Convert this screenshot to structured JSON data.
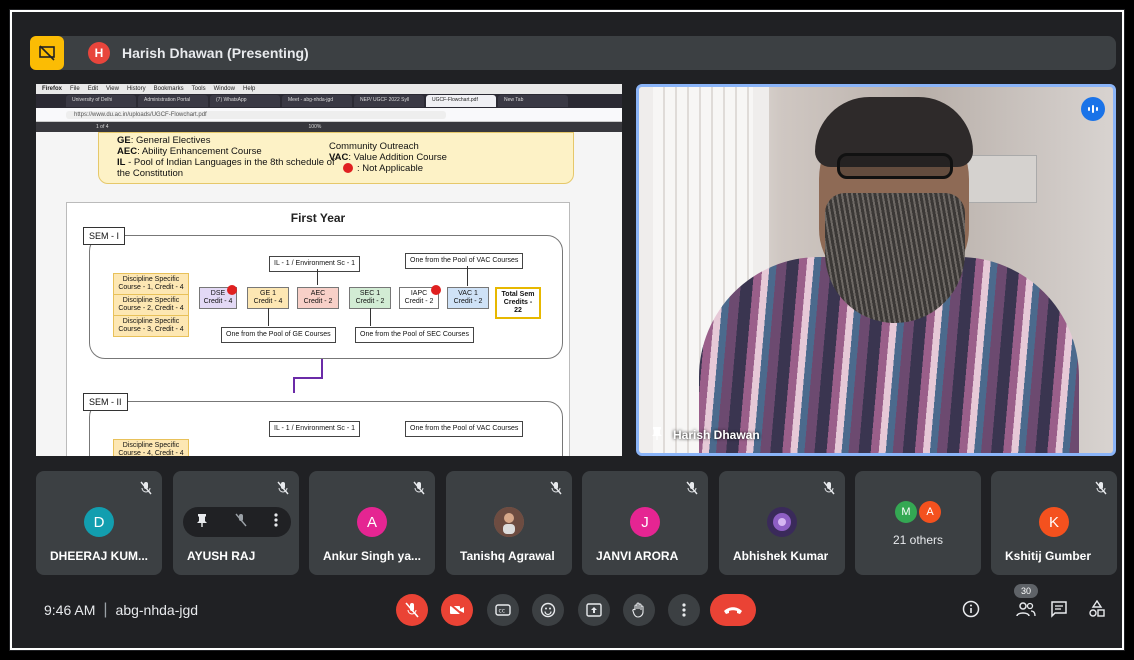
{
  "presenter": {
    "initial": "H",
    "title": "Harish Dhawan (Presenting)"
  },
  "shared_screen": {
    "menubar": [
      "Firefox",
      "File",
      "Edit",
      "View",
      "History",
      "Bookmarks",
      "Tools",
      "Window",
      "Help"
    ],
    "tabs": [
      "University of Delhi",
      "Administration Portal",
      "(7) WhatsApp",
      "Meet - abg-nhda-jgd",
      "NEP/ UGCF 2022 Syll",
      "UGCF-Flowchart.pdf",
      "New Tab"
    ],
    "url": "https://www.du.ac.in/uploads/UGCF-Flowchart.pdf",
    "pdf_page": "1 of 4",
    "pdf_zoom": "100%",
    "legend_left": [
      {
        "key": "GE",
        "text": ": General Electives"
      },
      {
        "key": "AEC",
        "text": ": Ability Enhancement Course"
      },
      {
        "key": "IL",
        "text": " - Pool of Indian Languages in the 8th schedule of the Constitution"
      }
    ],
    "legend_right": [
      {
        "key": "",
        "text": "Community Outreach"
      },
      {
        "key": "VAC",
        "text": ": Value Addition Course"
      },
      {
        "key": "",
        "text": ": Not Applicable"
      }
    ],
    "year_title": "First Year",
    "sem1": {
      "label": "SEM - I",
      "ds": [
        "Discipline Specific Course - 1, Credit - 4",
        "Discipline Specific Course - 2, Credit - 4",
        "Discipline Specific Course - 3, Credit - 4"
      ],
      "top_notes": [
        "IL - 1 / Environment Sc - 1",
        "One from the Pool of VAC Courses"
      ],
      "nodes": [
        {
          "name": "DSE",
          "credit": "Credit - 4",
          "color": "#e3d9f5"
        },
        {
          "name": "GE 1",
          "credit": "Credit - 4",
          "color": "#fde7b3"
        },
        {
          "name": "AEC",
          "credit": "Credit - 2",
          "color": "#f8d0c8"
        },
        {
          "name": "SEC 1",
          "credit": "Credit - 2",
          "color": "#d2ecd4"
        },
        {
          "name": "IAPC",
          "credit": "Credit - 2",
          "color": "#ffffff"
        },
        {
          "name": "VAC 1",
          "credit": "Credit - 2",
          "color": "#cfe2f7"
        }
      ],
      "total": "Total Sem Credits - 22",
      "bottom_notes": [
        "One from the Pool of GE Courses",
        "One from the Pool of SEC Courses"
      ]
    },
    "sem2": {
      "label": "SEM - II",
      "ds_first": "Discipline Specific Course - 4, Credit - 4",
      "top_notes": [
        "IL - 1 / Environment Sc - 1",
        "One from the Pool of VAC Courses"
      ]
    }
  },
  "self_video": {
    "name": "Harish Dhawan"
  },
  "tiles": [
    {
      "name": "DHEERAJ KUM...",
      "initial": "D",
      "color": "#129eaf"
    },
    {
      "name": "AYUSH RAJ",
      "initial": "",
      "color": ""
    },
    {
      "name": "Ankur Singh ya...",
      "initial": "A",
      "color": "#e52592"
    },
    {
      "name": "Tanishq Agrawal",
      "initial": "",
      "color": "#8a6a5a"
    },
    {
      "name": "JANVI ARORA",
      "initial": "J",
      "color": "#e52592"
    },
    {
      "name": "Abhishek Kumar",
      "initial": "",
      "color": "#6f3fa0"
    },
    {
      "name": "",
      "initial": "",
      "color": ""
    },
    {
      "name": "Kshitij Gumber",
      "initial": "K",
      "color": "#f4511e"
    }
  ],
  "others": {
    "label": "21 others",
    "a1": "M",
    "a1_color": "#34a853",
    "a2": "A",
    "a2_color": "#f4511e"
  },
  "bottom_bar": {
    "time": "9:46 AM",
    "meeting_code": "abg-nhda-jgd",
    "participant_count": "30"
  }
}
